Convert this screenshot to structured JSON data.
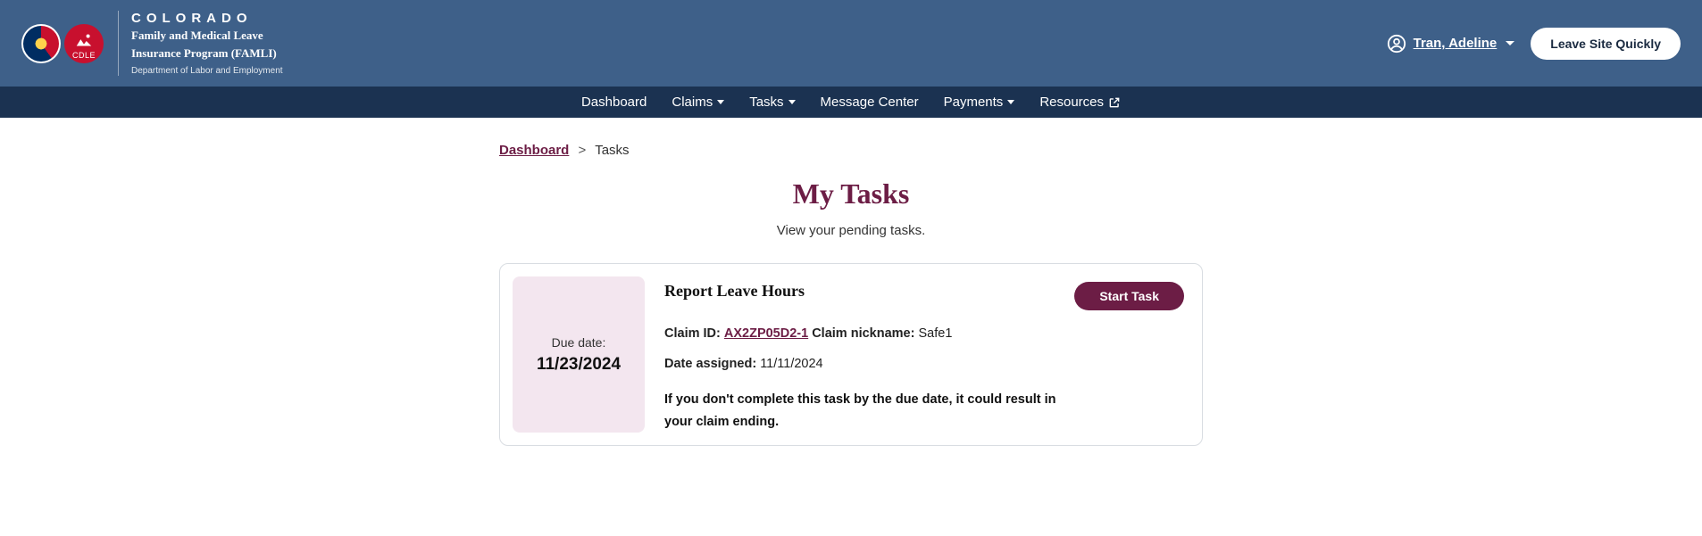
{
  "brand": {
    "title": "COLORADO",
    "subtitle1": "Family and Medical Leave",
    "subtitle2": "Insurance Program (FAMLI)",
    "dept": "Department of Labor and Employment",
    "cdle_label": "CDLE"
  },
  "header": {
    "user_name": "Tran, Adeline",
    "leave_label": "Leave Site Quickly"
  },
  "nav": {
    "dashboard": "Dashboard",
    "claims": "Claims",
    "tasks": "Tasks",
    "message_center": "Message Center",
    "payments": "Payments",
    "resources": "Resources"
  },
  "breadcrumb": {
    "dashboard": "Dashboard",
    "sep": ">",
    "current": "Tasks"
  },
  "page": {
    "title": "My Tasks",
    "subtitle": "View your pending tasks."
  },
  "task": {
    "due_label": "Due date:",
    "due_value": "11/23/2024",
    "title": "Report Leave Hours",
    "start_label": "Start Task",
    "claim_id_label": "Claim ID:",
    "claim_id_value": "AX2ZP05D2-1",
    "nickname_label": "Claim nickname:",
    "nickname_value": "Safe1",
    "date_assigned_label": "Date assigned:",
    "date_assigned_value": "11/11/2024",
    "warning": "If you don't complete this task by the due date, it could result in your claim ending."
  }
}
